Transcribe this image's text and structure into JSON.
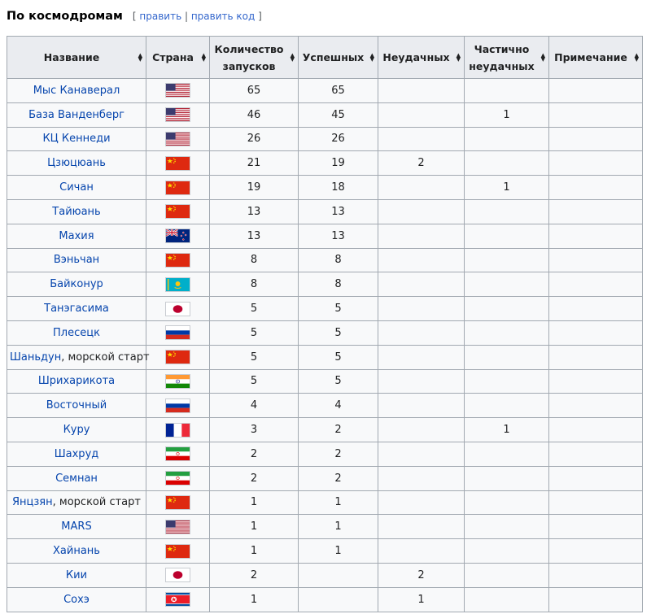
{
  "section": {
    "title": "По космодромам",
    "edit_open": "[ ",
    "edit_link": "править",
    "edit_sep": " | ",
    "edit_code_link": "править код",
    "edit_close": " ]"
  },
  "table": {
    "headers": [
      "Название",
      "Страна",
      "Количество запусков",
      "Успешных",
      "Неудачных",
      "Частично неудачных",
      "Примечание"
    ],
    "rows": [
      {
        "name": "Мыс Канаверал",
        "name_rest": "",
        "flag": "usa-flag-icon",
        "total": "65",
        "success": "65",
        "fail": "",
        "partial": "",
        "note": ""
      },
      {
        "name": "База Ванденберг",
        "name_rest": "",
        "flag": "usa-flag-icon",
        "total": "46",
        "success": "45",
        "fail": "",
        "partial": "1",
        "note": ""
      },
      {
        "name": "КЦ Кеннеди",
        "name_rest": "",
        "flag": "usa-flag-icon",
        "total": "26",
        "success": "26",
        "fail": "",
        "partial": "",
        "note": ""
      },
      {
        "name": "Цзюцюань",
        "name_rest": "",
        "flag": "china-flag-icon",
        "total": "21",
        "success": "19",
        "fail": "2",
        "partial": "",
        "note": ""
      },
      {
        "name": "Сичан",
        "name_rest": "",
        "flag": "china-flag-icon",
        "total": "19",
        "success": "18",
        "fail": "",
        "partial": "1",
        "note": ""
      },
      {
        "name": "Тайюань",
        "name_rest": "",
        "flag": "china-flag-icon",
        "total": "13",
        "success": "13",
        "fail": "",
        "partial": "",
        "note": ""
      },
      {
        "name": "Махия",
        "name_rest": "",
        "flag": "new-zealand-flag-icon",
        "total": "13",
        "success": "13",
        "fail": "",
        "partial": "",
        "note": ""
      },
      {
        "name": "Вэньчан",
        "name_rest": "",
        "flag": "china-flag-icon",
        "total": "8",
        "success": "8",
        "fail": "",
        "partial": "",
        "note": ""
      },
      {
        "name": "Байконур",
        "name_rest": "",
        "flag": "kazakhstan-flag-icon",
        "total": "8",
        "success": "8",
        "fail": "",
        "partial": "",
        "note": ""
      },
      {
        "name": "Танэгасима",
        "name_rest": "",
        "flag": "japan-flag-icon",
        "total": "5",
        "success": "5",
        "fail": "",
        "partial": "",
        "note": ""
      },
      {
        "name": "Плесецк",
        "name_rest": "",
        "flag": "russia-flag-icon",
        "total": "5",
        "success": "5",
        "fail": "",
        "partial": "",
        "note": ""
      },
      {
        "name": "Шаньдун",
        "name_rest": ", морской старт",
        "flag": "china-flag-icon",
        "total": "5",
        "success": "5",
        "fail": "",
        "partial": "",
        "note": ""
      },
      {
        "name": "Шрихарикота",
        "name_rest": "",
        "flag": "india-flag-icon",
        "total": "5",
        "success": "5",
        "fail": "",
        "partial": "",
        "note": ""
      },
      {
        "name": "Восточный",
        "name_rest": "",
        "flag": "russia-flag-icon",
        "total": "4",
        "success": "4",
        "fail": "",
        "partial": "",
        "note": ""
      },
      {
        "name": "Куру",
        "name_rest": "",
        "flag": "france-flag-icon",
        "total": "3",
        "success": "2",
        "fail": "",
        "partial": "1",
        "note": ""
      },
      {
        "name": "Шахруд",
        "name_rest": "",
        "flag": "iran-flag-icon",
        "total": "2",
        "success": "2",
        "fail": "",
        "partial": "",
        "note": ""
      },
      {
        "name": "Семнан",
        "name_rest": "",
        "flag": "iran-flag-icon",
        "total": "2",
        "success": "2",
        "fail": "",
        "partial": "",
        "note": ""
      },
      {
        "name": "Янцзян",
        "name_rest": ", морской старт",
        "flag": "china-flag-icon",
        "total": "1",
        "success": "1",
        "fail": "",
        "partial": "",
        "note": ""
      },
      {
        "name": "MARS",
        "name_rest": "",
        "flag": "usa-flag-icon",
        "total": "1",
        "success": "1",
        "fail": "",
        "partial": "",
        "note": ""
      },
      {
        "name": "Хайнань",
        "name_rest": "",
        "flag": "china-flag-icon",
        "total": "1",
        "success": "1",
        "fail": "",
        "partial": "",
        "note": ""
      },
      {
        "name": "Кии",
        "name_rest": "",
        "flag": "japan-flag-icon",
        "total": "2",
        "success": "",
        "fail": "2",
        "partial": "",
        "note": ""
      },
      {
        "name": "Сохэ",
        "name_rest": "",
        "flag": "north-korea-flag-icon",
        "total": "1",
        "success": "",
        "fail": "1",
        "partial": "",
        "note": ""
      }
    ]
  },
  "colors": {
    "link": "#0645ad",
    "header_bg": "#eaecf0",
    "cell_bg": "#f8f9fa",
    "border": "#a2a9b1"
  }
}
